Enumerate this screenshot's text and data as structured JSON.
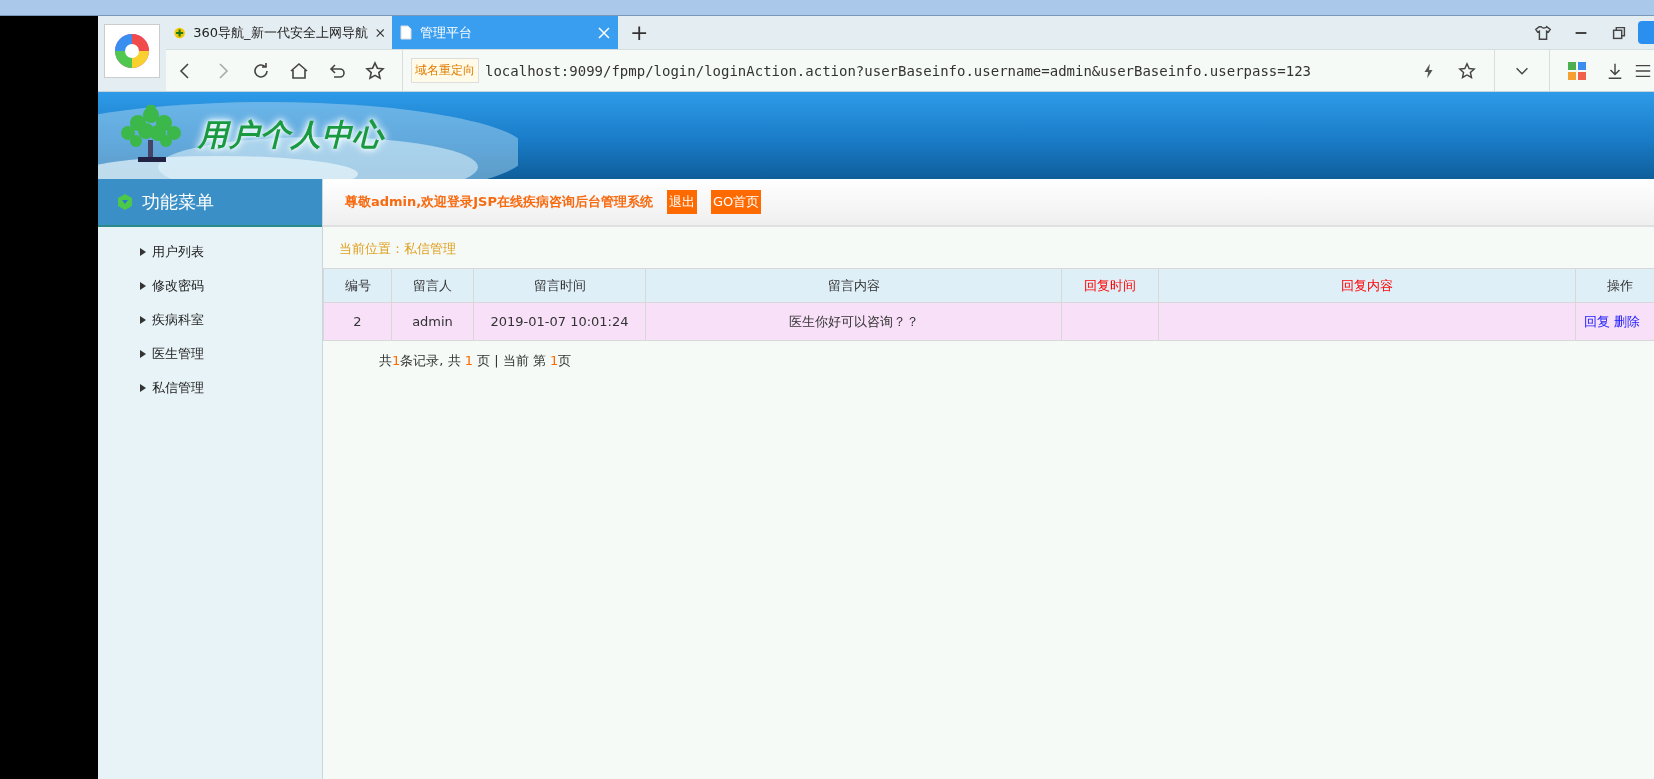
{
  "browser": {
    "tabs": [
      {
        "label": "360导航_新一代安全上网导航",
        "selected": false
      },
      {
        "label": "管理平台",
        "selected": true
      }
    ],
    "new_tab": "+",
    "address_bar": {
      "redirect_label": "域名重定向",
      "url": "localhost:9099/fpmp/login/loginAction.action?userBaseinfo.username=admin&userBaseinfo.userpass=123"
    }
  },
  "header": {
    "title": "用户个人中心"
  },
  "sidebar": {
    "title": "功能菜单",
    "items": [
      {
        "label": "用户列表"
      },
      {
        "label": "修改密码"
      },
      {
        "label": "疾病科室"
      },
      {
        "label": "医生管理"
      },
      {
        "label": "私信管理"
      }
    ]
  },
  "welcome": {
    "text": "尊敬admin,欢迎登录JSP在线疾病咨询后台管理系统",
    "buttons": [
      "退出",
      "GO首页"
    ]
  },
  "breadcrumb": "当前位置：私信管理",
  "table": {
    "columns": [
      {
        "label": "编号",
        "emphasized": false
      },
      {
        "label": "留言人",
        "emphasized": false
      },
      {
        "label": "留言时间",
        "emphasized": false
      },
      {
        "label": "留言内容",
        "emphasized": false
      },
      {
        "label": "回复时间",
        "emphasized": true
      },
      {
        "label": "回复内容",
        "emphasized": true
      },
      {
        "label": "操作",
        "emphasized": false
      }
    ],
    "rows": [
      {
        "highlighted": true,
        "cells": [
          "2",
          "admin",
          "2019-01-07 10:01:24",
          "医生你好可以咨询？？",
          "",
          ""
        ],
        "actions": [
          "回复",
          "删除"
        ]
      }
    ]
  },
  "pagination": [
    {
      "text": "共",
      "highlight": false
    },
    {
      "text": "1",
      "highlight": true
    },
    {
      "text": "条记录, 共 ",
      "highlight": false
    },
    {
      "text": "1",
      "highlight": true
    },
    {
      "text": " 页 | 当前 第 ",
      "highlight": false
    },
    {
      "text": "1",
      "highlight": true
    },
    {
      "text": "页",
      "highlight": false
    }
  ]
}
